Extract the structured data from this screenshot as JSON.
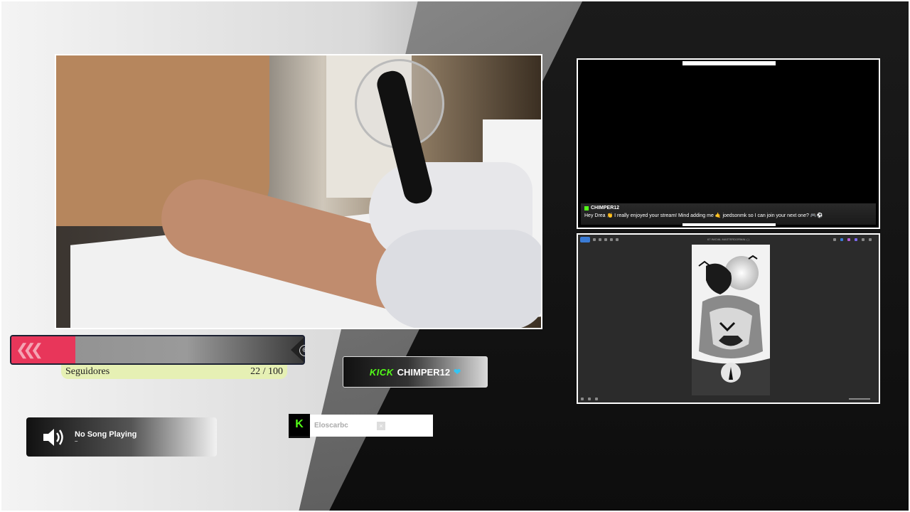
{
  "goal": {
    "label": "Seguidores",
    "current": 22,
    "target": 100,
    "progress_text": "22 / 100",
    "fill_color": "#e8365a"
  },
  "kick_badge": {
    "brand": "KICK",
    "channel": "CHIMPER12",
    "brand_color": "#53fc18"
  },
  "now_playing": {
    "title": "No Song Playing",
    "subtitle": "–",
    "icon": "speaker-icon"
  },
  "follower_alert": {
    "logo": "K",
    "username": "Eloscarbc"
  },
  "chat": {
    "username": "CHIMPER12",
    "message": "Hey Drea 👏 I really enjoyed your stream! Mind adding me 🤙 joedsonmk so I can join your next one? 🎮⚽"
  },
  "viewer": {
    "title": "67 INICIAL MASTERDORMAL ( )",
    "image_name": "wolf-raven-tattoo-stencil"
  },
  "colors": {
    "kick_green": "#53fc18",
    "accent_pink": "#e8365a",
    "label_bg": "#e6f0b4"
  }
}
